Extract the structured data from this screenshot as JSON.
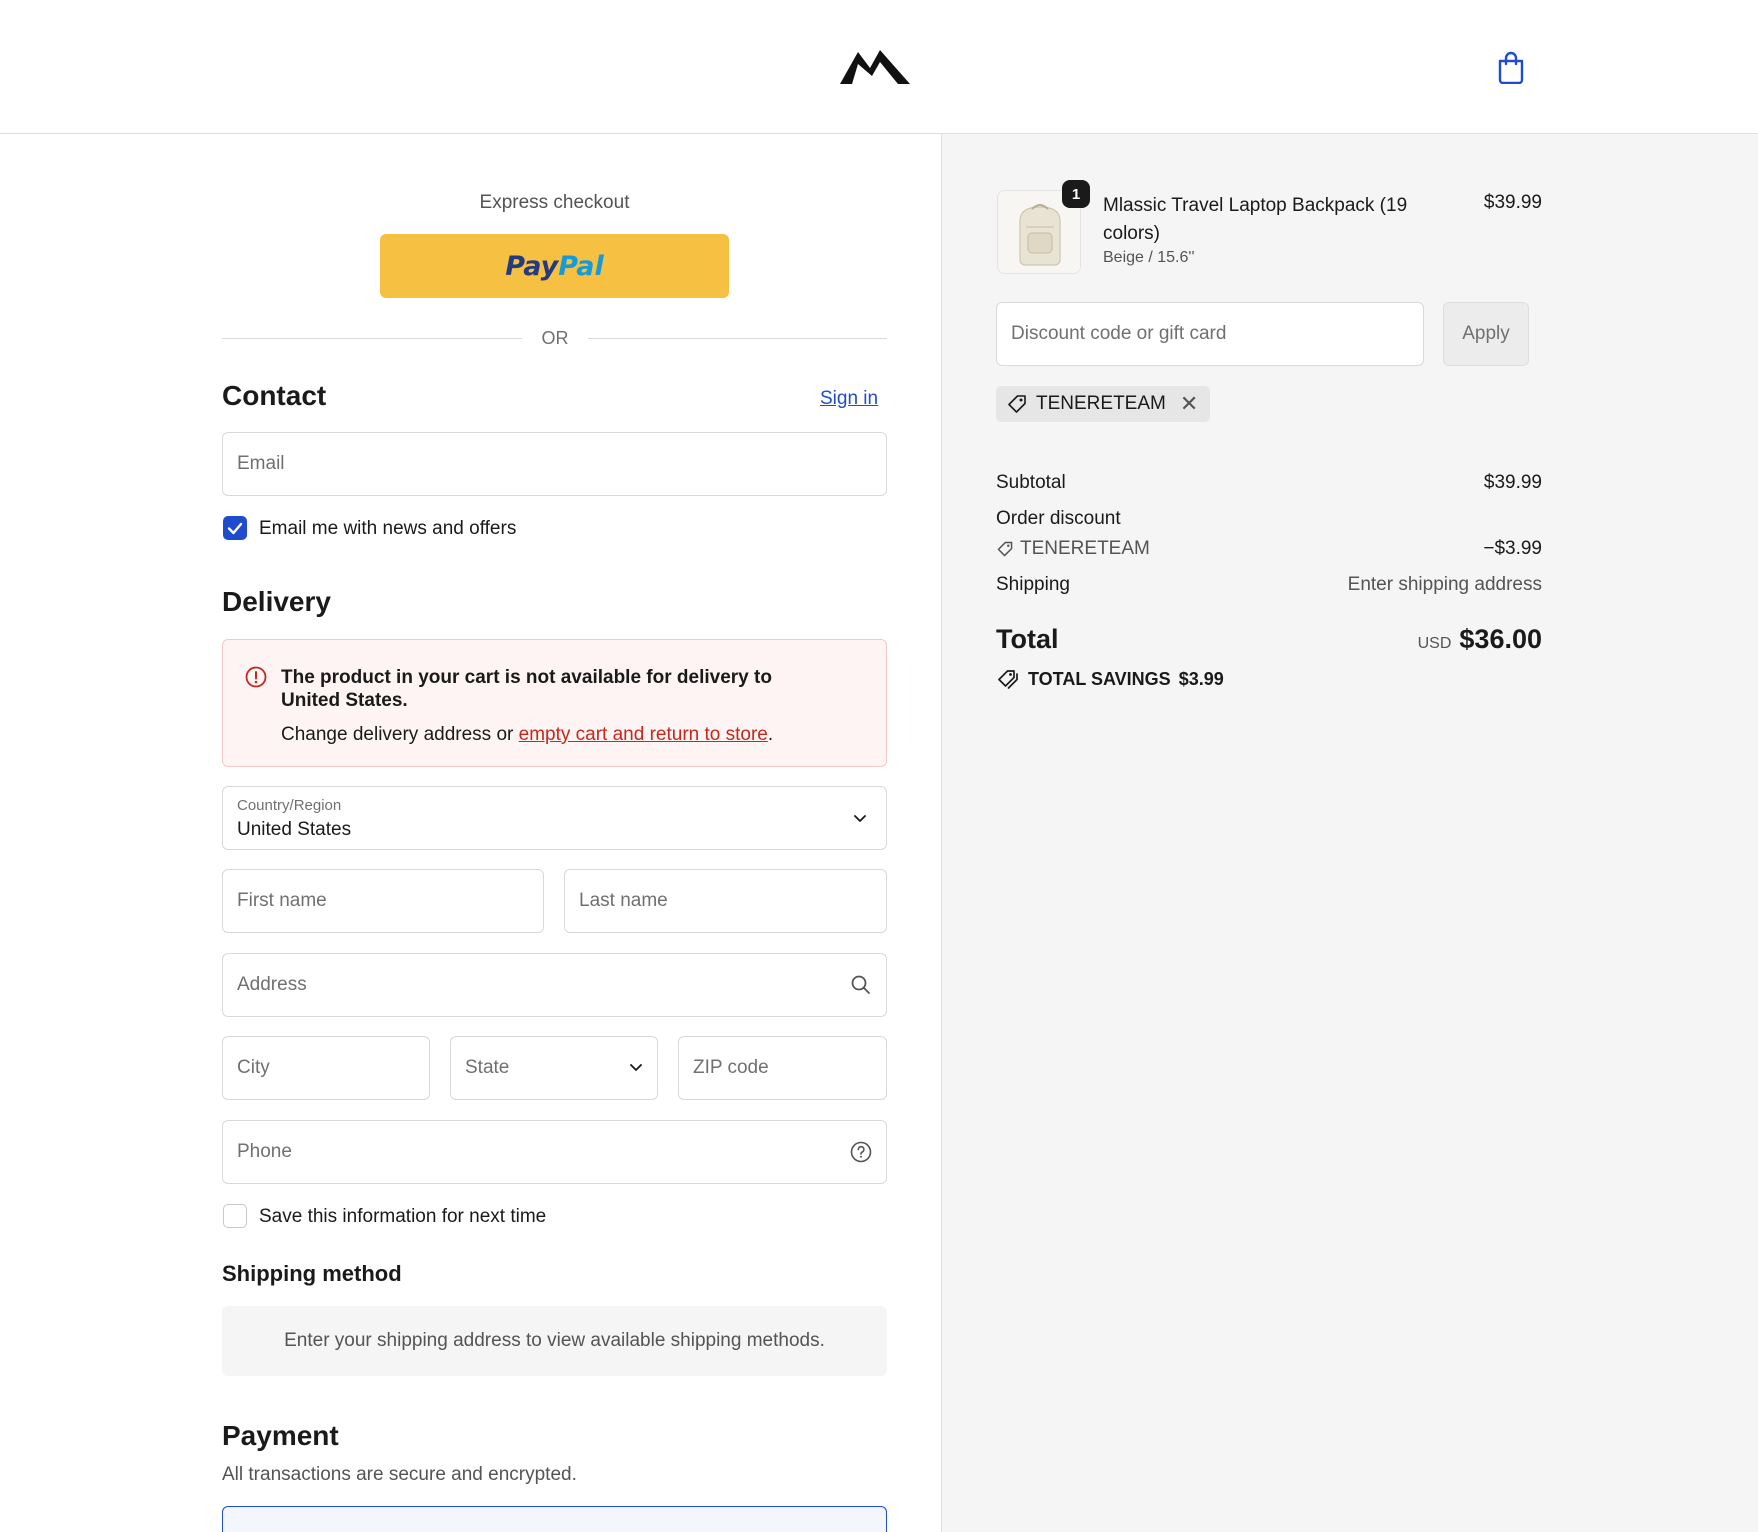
{
  "header": {
    "logo_icon": "mountain-logo-icon",
    "cart_icon": "shopping-bag-icon"
  },
  "express": {
    "title": "Express checkout",
    "paypal_part1": "Pay",
    "paypal_part2": "Pal",
    "or_text": "OR"
  },
  "contact": {
    "title": "Contact",
    "sign_in": "Sign in",
    "email_placeholder": "Email",
    "newsletter_label": "Email me with news and offers",
    "newsletter_checked": true
  },
  "delivery": {
    "title": "Delivery",
    "alert_title": "The product in your cart is not available for delivery to United States.",
    "alert_body_prefix": "Change delivery address or ",
    "alert_link": "empty cart and return to store",
    "alert_body_suffix": ".",
    "country_label": "Country/Region",
    "country_value": "United States",
    "first_name_placeholder": "First name",
    "last_name_placeholder": "Last name",
    "address_placeholder": "Address",
    "city_placeholder": "City",
    "state_placeholder": "State",
    "zip_placeholder": "ZIP code",
    "phone_placeholder": "Phone",
    "save_info_label": "Save this information for next time",
    "save_info_checked": false
  },
  "shipping": {
    "title": "Shipping method",
    "message": "Enter your shipping address to view available shipping methods."
  },
  "payment": {
    "title": "Payment",
    "subtitle": "All transactions are secure and encrypted."
  },
  "order": {
    "product_name": "Mlassic Travel Laptop Backpack (19 colors)",
    "product_variant": "Beige / 15.6''",
    "quantity": "1",
    "price": "$39.99",
    "discount_placeholder": "Discount code or gift card",
    "apply_label": "Apply",
    "applied_code": "TENERETEAM",
    "subtotal_label": "Subtotal",
    "subtotal_value": "$39.99",
    "order_discount_label": "Order discount",
    "discount_code": "TENERETEAM",
    "discount_value": "−$3.99",
    "shipping_label": "Shipping",
    "shipping_value": "Enter shipping address",
    "total_label": "Total",
    "currency": "USD",
    "total_value": "$36.00",
    "savings_label": "TOTAL SAVINGS",
    "savings_value": "$3.99"
  },
  "colors": {
    "accent": "#1f4ccf",
    "paypal_yellow": "#f6c142",
    "error_red": "#c4281c"
  }
}
